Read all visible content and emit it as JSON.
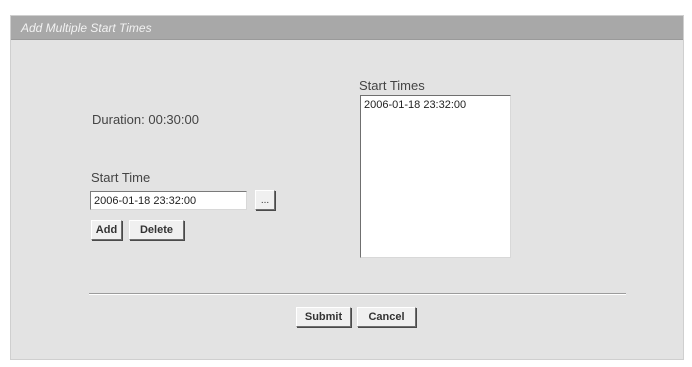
{
  "dialog": {
    "title": "Add Multiple Start Times",
    "duration_text": "Duration: 00:30:00",
    "start_time_label": "Start Time",
    "start_time_value": "2006-01-18 23:32:00",
    "picker_label": "...",
    "add_label": "Add",
    "delete_label": "Delete",
    "start_times_label": "Start Times",
    "start_times": [
      "2006-01-18 23:32:00"
    ],
    "submit_label": "Submit",
    "cancel_label": "Cancel"
  }
}
